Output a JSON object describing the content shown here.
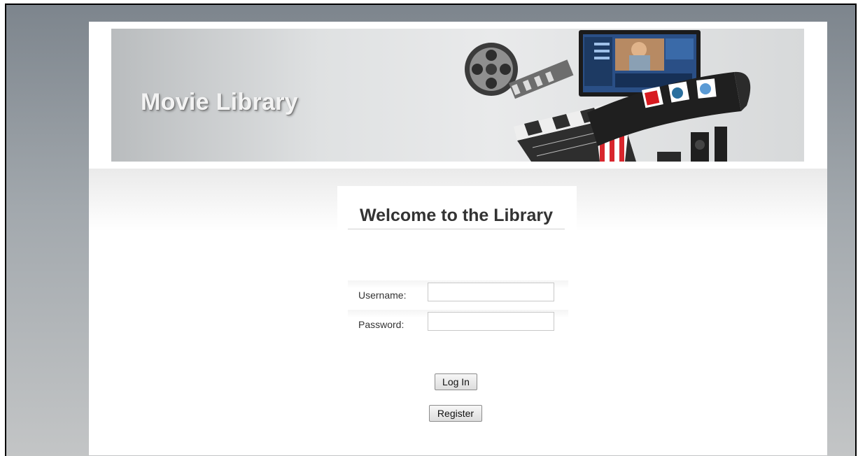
{
  "header": {
    "site_title": "Movie Library"
  },
  "login": {
    "welcome_heading": "Welcome to the Library",
    "username_label": "Username:",
    "username_value": "",
    "password_label": "Password:",
    "password_value": "",
    "login_button": "Log In",
    "register_button": "Register"
  },
  "colors": {
    "outer_background": "#8f969c",
    "page_background": "#ffffff",
    "title_text": "#f3f3f3"
  }
}
